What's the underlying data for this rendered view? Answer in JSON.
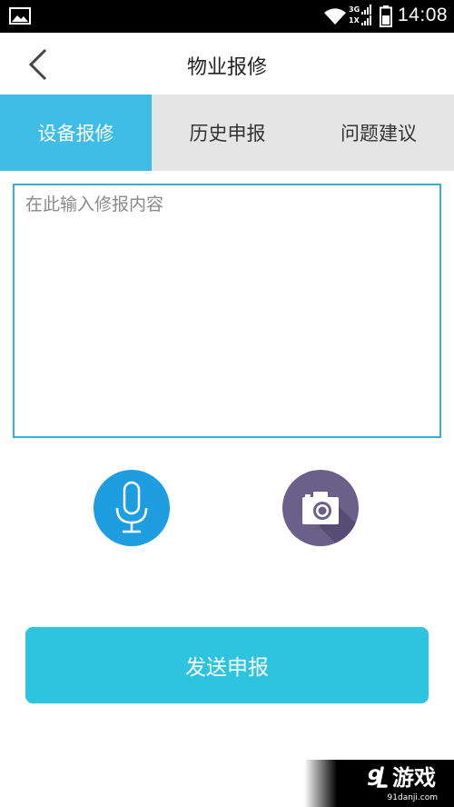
{
  "status_bar": {
    "time": "14:08",
    "network_top": "3G",
    "network_bottom": "1X",
    "icons": [
      "gallery-icon",
      "wifi-icon",
      "signal-icon",
      "battery-icon"
    ]
  },
  "header": {
    "title": "物业报修",
    "back_icon": "chevron-left-icon"
  },
  "tabs": [
    {
      "label": "设备报修",
      "active": true
    },
    {
      "label": "历史申报",
      "active": false
    },
    {
      "label": "问题建议",
      "active": false
    }
  ],
  "form": {
    "content_placeholder": "在此输入修报内容",
    "content_value": "",
    "mic_icon": "microphone-icon",
    "camera_icon": "camera-icon",
    "submit_label": "发送申报"
  },
  "watermark": {
    "logo_text": "游戏",
    "url": "91danji.com"
  },
  "colors": {
    "active_tab": "#3fbde6",
    "tab_bg": "#e5e5e5",
    "input_border": "#3aaed8",
    "mic_button": "#1e9ee0",
    "camera_button": "#6b6089",
    "submit_button": "#2ec3de"
  }
}
